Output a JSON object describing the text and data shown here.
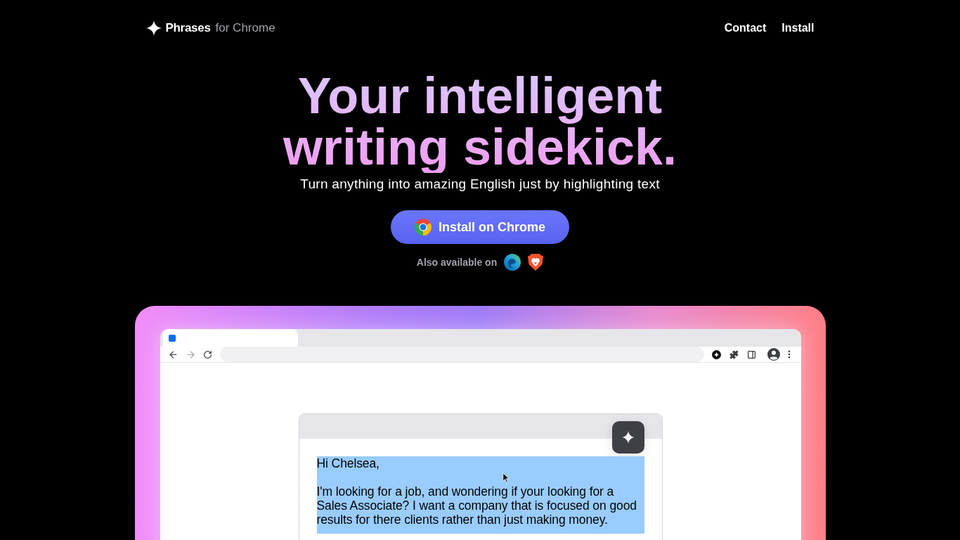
{
  "nav": {
    "brand": "Phrases",
    "brand_suffix": "for Chrome",
    "links": [
      {
        "label": "Contact"
      },
      {
        "label": "Install"
      }
    ]
  },
  "hero": {
    "title": "Your intelligent writing sidekick.",
    "subtitle": "Turn anything into amazing English just by highlighting text",
    "install_button": "Install on Chrome",
    "also_available": {
      "label": "Also available on",
      "browsers": [
        {
          "kind": "edge"
        },
        {
          "kind": "brave"
        }
      ]
    }
  },
  "demo": {
    "editor": {
      "highlighted": true,
      "paragraphs": [
        "Hi Chelsea,",
        "I'm looking for a job, and wondering if your looking for a Sales Associate? I want a company that is focused on good results for there clients rather than just making money."
      ]
    }
  }
}
